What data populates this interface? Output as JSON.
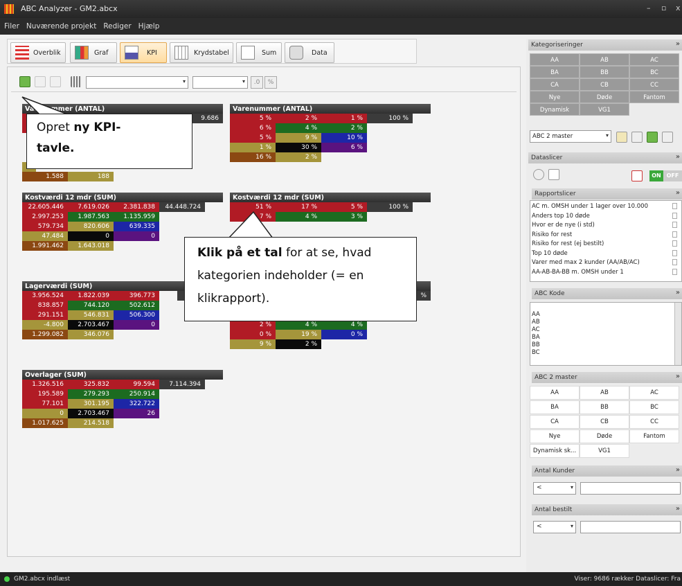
{
  "window": {
    "title": "ABC Analyzer - GM2.abcx",
    "min": "–",
    "max": "▫",
    "close": "x"
  },
  "menu": [
    "Filer",
    "Nuværende projekt",
    "Rediger",
    "Hjælp"
  ],
  "tabs": [
    {
      "label": "Overblik"
    },
    {
      "label": "Graf"
    },
    {
      "label": "KPI"
    },
    {
      "label": "Krydstabel"
    },
    {
      "label": "Sum"
    },
    {
      "label": "Data"
    }
  ],
  "toolbar": {
    "btn_decimal": ".0",
    "btn_percent": "%"
  },
  "boards": {
    "b1": {
      "title": "Varenummer (ANTAL)",
      "total": "9.686",
      "r5": [
        "1.588",
        "188"
      ]
    },
    "b2": {
      "title": "Varenummer (ANTAL)",
      "rows": [
        [
          "5 %",
          "2 %",
          "1 %",
          "100 %"
        ],
        [
          "6 %",
          "4 %",
          "2 %"
        ],
        [
          "5 %",
          "9 %",
          "10 %"
        ],
        [
          "1 %",
          "30 %",
          "6 %"
        ],
        [
          "16 %",
          "2 %"
        ]
      ]
    },
    "b3": {
      "title": "Kostværdi 12 mdr (SUM)",
      "rows": [
        [
          "22.605.446",
          "7.619.026",
          "2.381.838",
          "44.448.724"
        ],
        [
          "2.997.253",
          "1.987.563",
          "1.135.959"
        ],
        [
          "579.734",
          "820.606",
          "639.335"
        ],
        [
          "47.484",
          "0",
          "0"
        ],
        [
          "1.991.462",
          "1.643.018"
        ]
      ]
    },
    "b4": {
      "title": "Kostværdi 12 mdr (SUM)",
      "rows": [
        [
          "51 %",
          "17 %",
          "5 %",
          "100 %"
        ],
        [
          "7 %",
          "4 %",
          "3 %"
        ]
      ]
    },
    "b5": {
      "title": "Lagerværdi (SUM)",
      "rows": [
        [
          "3.956.524",
          "1.822.039",
          "396.773"
        ],
        [
          "838.857",
          "744.120",
          "502.612"
        ],
        [
          "291.151",
          "546.831",
          "506.300"
        ],
        [
          "-4.800",
          "2.703.467",
          "0"
        ],
        [
          "1.299.082",
          "346.076"
        ]
      ]
    },
    "b6": {
      "title": "",
      "r1_total": "%",
      "rows": [
        [
          "2 %",
          "4 %",
          "4 %"
        ],
        [
          "0 %",
          "19 %",
          "0 %"
        ],
        [
          "9 %",
          "2 %"
        ]
      ]
    },
    "b7": {
      "title": "Overlager (SUM)",
      "rows": [
        [
          "1.326.516",
          "325.832",
          "99.594",
          "7.114.394"
        ],
        [
          "195.589",
          "279.293",
          "250.914"
        ],
        [
          "77.101",
          "301.195",
          "322.722"
        ],
        [
          "0",
          "2.703.467",
          "26"
        ],
        [
          "1.017.625",
          "214.518"
        ]
      ]
    }
  },
  "callouts": {
    "c1": {
      "pre": "Opret ",
      "bold": "ny KPI-",
      "line2": "tavle."
    },
    "c2": {
      "bold": "Klik på et tal",
      "rest": " for at se, hvad",
      "line2": "kategorien indeholder (= en",
      "line3": "klikrapport)."
    }
  },
  "sidebar": {
    "kategoriseringer": {
      "title": "Kategoriseringer",
      "chev": "»",
      "cells": [
        "AA",
        "AB",
        "AC",
        "BA",
        "BB",
        "BC",
        "CA",
        "CB",
        "CC",
        "Nye",
        "Døde",
        "Fantom",
        "Dynamisk",
        "VG1"
      ],
      "select": "ABC 2 master"
    },
    "dataslicer": {
      "title": "Dataslicer",
      "chev": "»",
      "on": "ON",
      "off": "OFF"
    },
    "rapportslicer": {
      "title": "Rapportslicer",
      "chev": "»",
      "items": [
        "AC m. OMSH under 1 lager over 10.000",
        "Anders top 10 døde",
        "Hvor er de nye (i std)",
        "Risiko for rest",
        "Risiko for rest (ej bestilt)",
        "Top 10 døde",
        "Varer med max 2 kunder (AA/AB/AC)",
        "AA-AB-BA-BB m. OMSH under 1"
      ]
    },
    "abckode": {
      "title": "ABC Kode",
      "chev": "»",
      "items": [
        "AA",
        "AB",
        "AC",
        "BA",
        "BB",
        "BC"
      ]
    },
    "abc2master": {
      "title": "ABC 2 master",
      "chev": "»",
      "cells": [
        "AA",
        "AB",
        "AC",
        "BA",
        "BB",
        "BC",
        "CA",
        "CB",
        "CC",
        "Nye",
        "Døde",
        "Fantom",
        "Dynamisk sk...",
        "VG1"
      ]
    },
    "antalkunder": {
      "title": "Antal Kunder",
      "chev": "»",
      "op": "<"
    },
    "antalbestilt": {
      "title": "Antal bestilt",
      "chev": "»",
      "op": "<"
    }
  },
  "status": {
    "left": "GM2.abcx indlæst",
    "right": "Viser: 9686 rækker  Dataslicer: Fra"
  }
}
